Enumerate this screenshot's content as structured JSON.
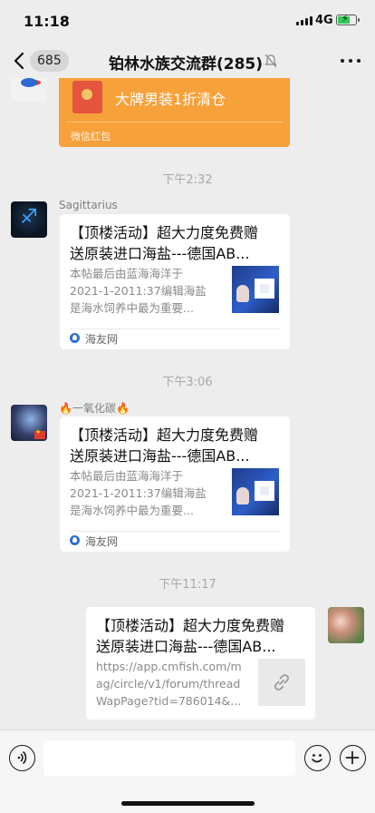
{
  "status_bar": {
    "time": "11:18",
    "location_glyph": "➚",
    "network": "4G",
    "battery_level": 0.7
  },
  "nav": {
    "unread_count": "685",
    "title": "铂林水族交流群(285)"
  },
  "red_packet": {
    "text": "大牌男装1折清仓",
    "label": "微信红包"
  },
  "messages": [
    {
      "timestamp": "下午2:32",
      "sender": "Sagittarius",
      "card": {
        "title": "【顶楼活动】超大力度免费赠\n送原装进口海盐---德国AB...",
        "desc": "本帖最后由蓝海海洋于\n2021-1-2011:37编辑海盐\n是海水饲养中最为重要...",
        "source": "海友网"
      }
    },
    {
      "timestamp": "下午3:06",
      "sender": "🔥一氧化碳🔥",
      "card": {
        "title": "【顶楼活动】超大力度免费赠\n送原装进口海盐---德国AB...",
        "desc": "本帖最后由蓝海海洋于\n2021-1-2011:37编辑海盐\n是海水饲养中最为重要...",
        "source": "海友网"
      }
    },
    {
      "timestamp": "下午11:17",
      "card": {
        "title": "【顶楼活动】超大力度免费赠\n送原装进口海盐---德国AB...",
        "desc": "https://app.cmfish.com/m\nag/circle/v1/forum/thread\nWapPage?tid=786014&..."
      }
    }
  ],
  "input": {
    "value": "",
    "placeholder": ""
  },
  "colors": {
    "background": "#ededed",
    "red_packet": "#f7a13a",
    "card": "#ffffff",
    "timestamp": "#a8a8a8"
  },
  "icons": [
    "back-chevron-icon",
    "mute-bell-icon",
    "more-icon",
    "voice-icon",
    "emoji-icon",
    "plus-icon",
    "link-icon",
    "source-icon"
  ]
}
